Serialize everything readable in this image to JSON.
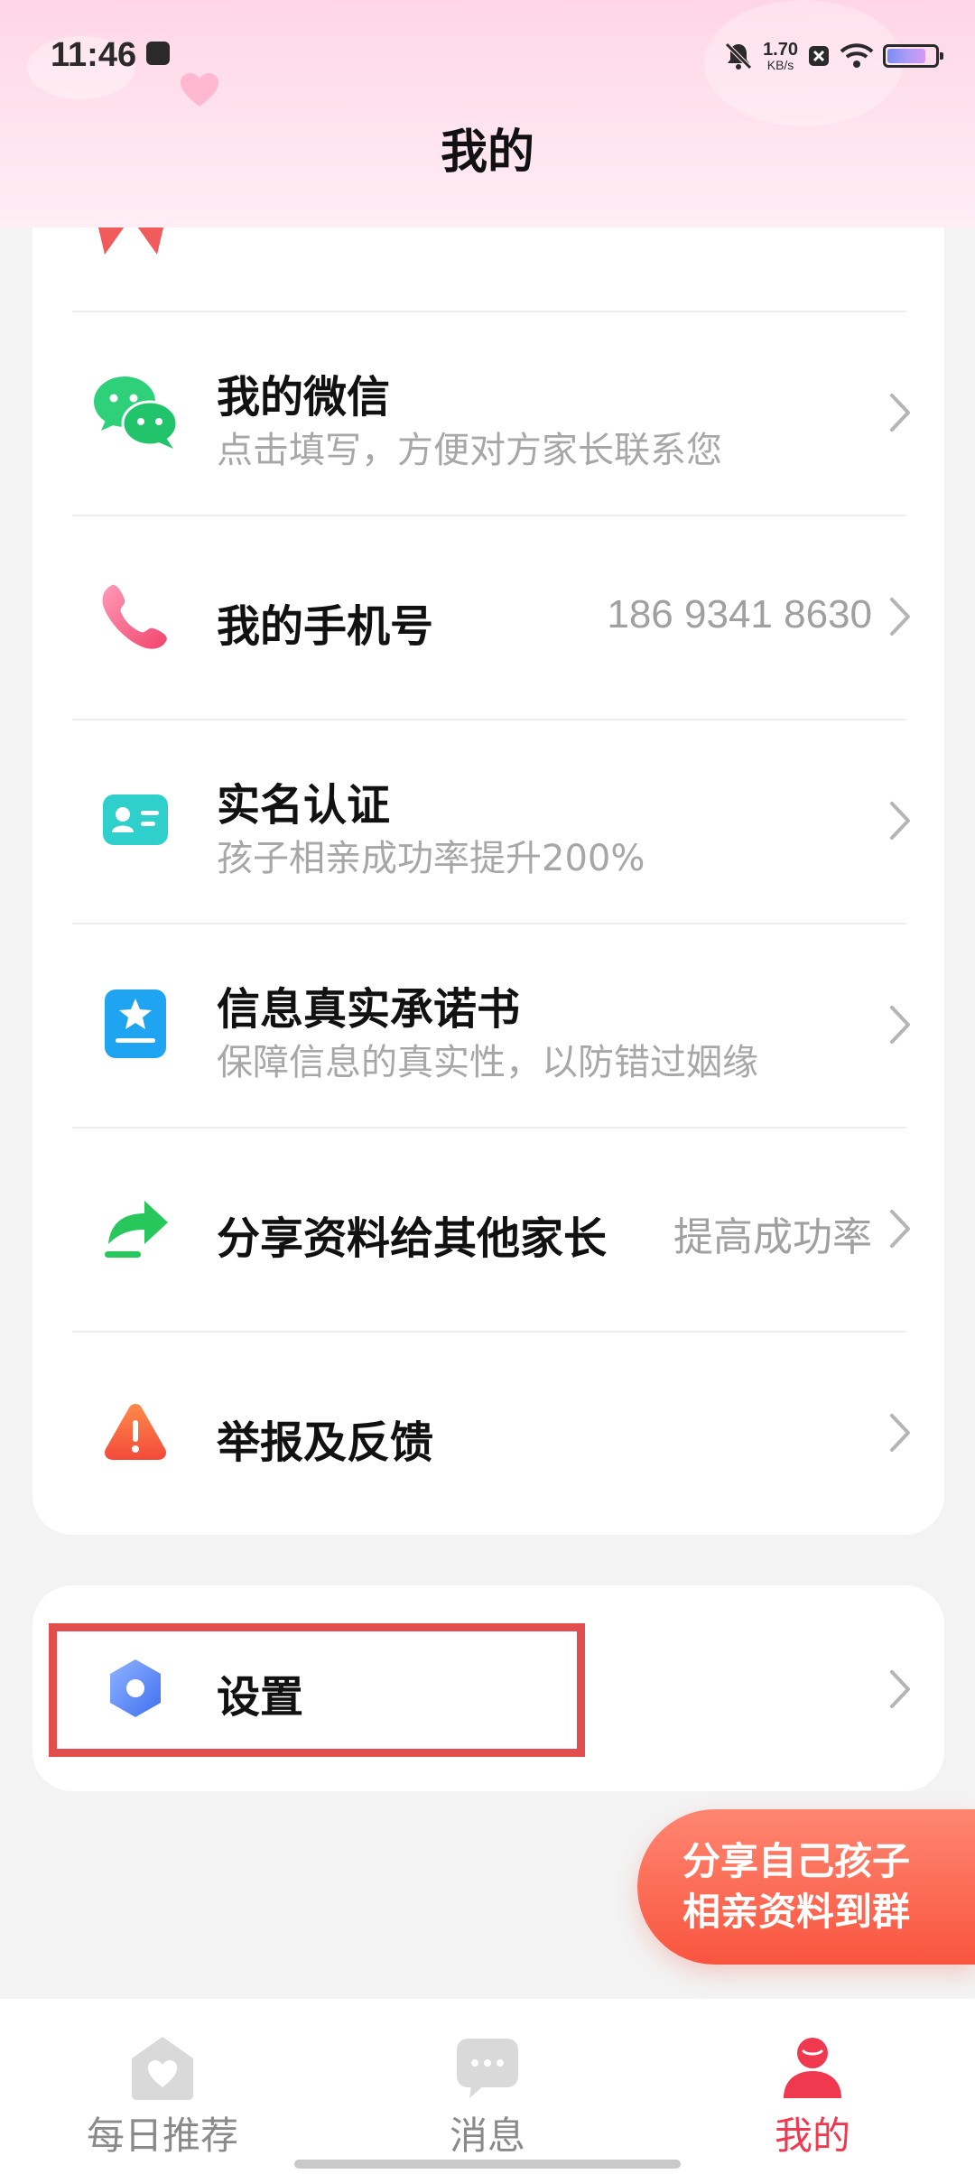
{
  "status_bar": {
    "time": "11:46",
    "net_speed_value": "1.70",
    "net_speed_unit": "KB/s",
    "battery_level": 0.8
  },
  "header": {
    "title": "我的"
  },
  "menu": {
    "items": [
      {
        "title": "我的微信",
        "subtitle": "点击填写，方便对方家长联系您",
        "right_text": "",
        "icon": "wechat-icon"
      },
      {
        "title": "我的手机号",
        "subtitle": "",
        "right_text": "186 9341 8630",
        "icon": "phone-icon"
      },
      {
        "title": "实名认证",
        "subtitle": "孩子相亲成功率提升200%",
        "right_text": "",
        "icon": "id-card-icon"
      },
      {
        "title": "信息真实承诺书",
        "subtitle": "保障信息的真实性，以防错过姻缘",
        "right_text": "",
        "icon": "pledge-icon"
      },
      {
        "title": "分享资料给其他家长",
        "subtitle": "",
        "right_text": "提高成功率",
        "icon": "share-icon"
      },
      {
        "title": "举报及反馈",
        "subtitle": "",
        "right_text": "",
        "icon": "report-icon"
      }
    ]
  },
  "settings": {
    "title": "设置",
    "icon": "settings-icon"
  },
  "share_fab": {
    "line1": "分享自己孩子",
    "line2": "相亲资料到群"
  },
  "bottom_nav": {
    "tabs": [
      {
        "label": "每日推荐",
        "icon": "home-heart-icon",
        "active": false
      },
      {
        "label": "消息",
        "icon": "message-icon",
        "active": false
      },
      {
        "label": "我的",
        "icon": "profile-icon",
        "active": true
      }
    ]
  },
  "colors": {
    "accent": "#f0384f",
    "header_pink": "#ffd6e6",
    "highlight_box": "#e24e4e",
    "fab": "#f9553f"
  }
}
